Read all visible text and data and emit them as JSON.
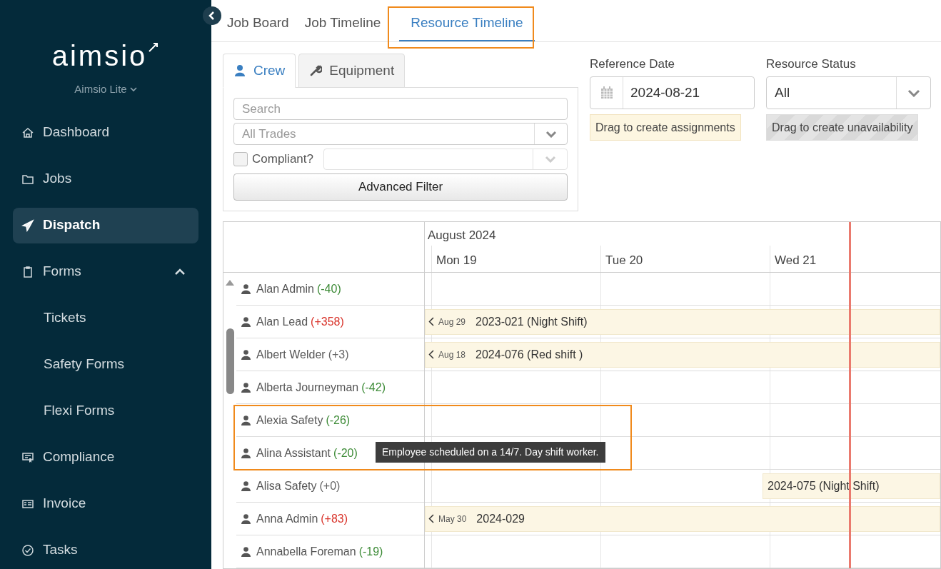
{
  "sidebar": {
    "logo": "aimsio",
    "plan": "Aimsio Lite",
    "items": [
      {
        "label": "Dashboard",
        "selected": false
      },
      {
        "label": "Jobs",
        "selected": false
      },
      {
        "label": "Dispatch",
        "selected": true
      },
      {
        "label": "Forms",
        "selected": false,
        "expanded": true,
        "children": [
          {
            "label": "Tickets",
            "selected": false
          },
          {
            "label": "Safety Forms",
            "selected": false
          },
          {
            "label": "Flexi Forms",
            "selected": false
          }
        ]
      },
      {
        "label": "Compliance",
        "selected": false
      },
      {
        "label": "Invoice",
        "selected": false
      },
      {
        "label": "Tasks",
        "selected": false
      }
    ]
  },
  "tabs": [
    {
      "label": "Job Board",
      "selected": false
    },
    {
      "label": "Job Timeline",
      "selected": false
    },
    {
      "label": "Resource Timeline",
      "selected": true
    }
  ],
  "resource_tabs": [
    {
      "label": "Crew",
      "selected": true
    },
    {
      "label": "Equipment",
      "selected": false
    }
  ],
  "filters": {
    "search": {
      "placeholder": "Search"
    },
    "trade": {
      "placeholder": "All Trades"
    },
    "compliant": {
      "label": "Compliant?",
      "checked": false
    },
    "advanced_button": "Advanced Filter"
  },
  "reference_date": {
    "label": "Reference Date",
    "value": "2024-08-21"
  },
  "resource_status": {
    "label": "Resource Status",
    "value": "All"
  },
  "legend": [
    {
      "label": "Drag to create assignments",
      "kind": "assignment"
    },
    {
      "label": "Drag to create unavailability",
      "kind": "unavailability"
    }
  ],
  "timeline": {
    "month": "August 2024",
    "days": [
      "Mon 19",
      "Tue 20",
      "Wed 21"
    ],
    "rows": [
      {
        "name": "Alan Admin",
        "delta": "(-40)",
        "color": "#3d8b37"
      },
      {
        "name": "Alan Lead",
        "delta": "(+358)",
        "color": "#d9342b",
        "event": {
          "kind": "continued",
          "from": "Aug 29",
          "label": "2023-021 (Night Shift)"
        }
      },
      {
        "name": "Albert Welder",
        "delta": "(+3)",
        "color": "#666666",
        "event": {
          "kind": "continued",
          "from": "Aug 18",
          "label": "2024-076 (Red shift )"
        }
      },
      {
        "name": "Alberta Journeyman",
        "delta": "(-42)",
        "color": "#3d8b37"
      },
      {
        "name": "Alexia Safety",
        "delta": "(-26)",
        "color": "#3d8b37"
      },
      {
        "name": "Alina Assistant",
        "delta": "(-20)",
        "color": "#3d8b37"
      },
      {
        "name": "Alisa Safety",
        "delta": "(+0)",
        "color": "#666666",
        "event": {
          "kind": "starts",
          "label": "2024-075 (Night Shift)"
        }
      },
      {
        "name": "Anna Admin",
        "delta": "(+83)",
        "color": "#d9342b",
        "event": {
          "kind": "continued",
          "from": "May 30",
          "label": "2024-029"
        }
      },
      {
        "name": "Annabella Foreman",
        "delta": "(-19)",
        "color": "#3d8b37"
      }
    ]
  },
  "tooltip": "Employee scheduled on a 14/7. Day shift worker."
}
